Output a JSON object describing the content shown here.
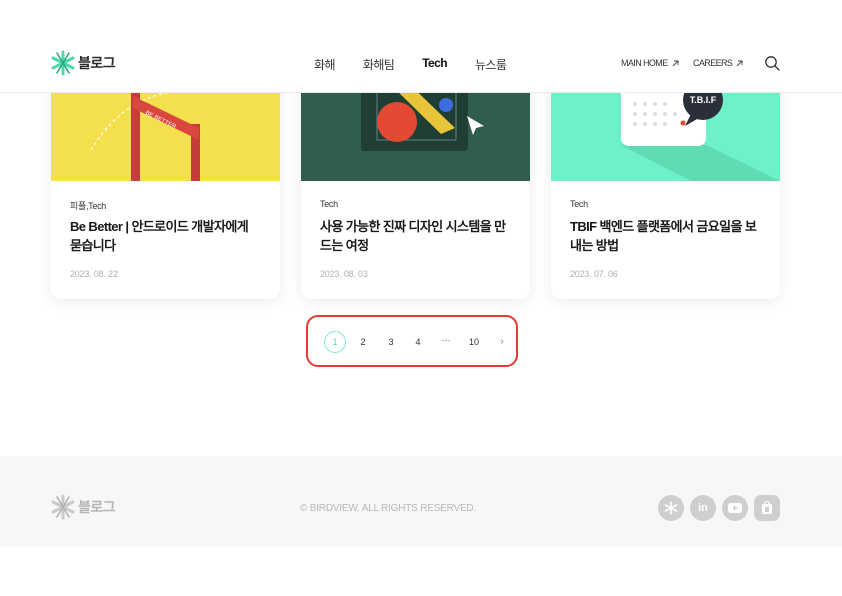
{
  "header": {
    "logo_text": "블로그",
    "nav": [
      "화해",
      "화해팀",
      "Tech",
      "뉴스룸"
    ],
    "active_nav": "Tech",
    "main_home": "MAIN HOME",
    "careers": "CAREERS"
  },
  "cards": [
    {
      "category": "피플,Tech",
      "title": "Be Better | 안드로이드 개발자에게 묻습니다",
      "date": "2023. 08. 22",
      "banner_text": "BE BETTER"
    },
    {
      "category": "Tech",
      "title": "사용 가능한 진짜 디자인 시스템을 만드는 여정",
      "date": "2023. 08. 03"
    },
    {
      "category": "Tech",
      "title": "TBIF 백엔드 플랫폼에서 금요일을 보내는 방법",
      "date": "2023. 07. 06",
      "bubble_text": "T.B.I.F"
    }
  ],
  "pagination": {
    "current": "1",
    "pages": [
      "1",
      "2",
      "3",
      "4",
      "10"
    ],
    "ellipsis": "···",
    "next": "›"
  },
  "footer": {
    "logo_text": "블로그",
    "copyright": "© BIRDVIEW. ALL RIGHTS RESERVED.",
    "social": [
      "hwahae-icon",
      "linkedin-icon",
      "youtube-icon",
      "app-store-icon"
    ],
    "linkedin_label": "in"
  },
  "colors": {
    "accent_mint": "#5ccfc0",
    "highlight_red": "#e53935",
    "card1_bg": "#f4e04d",
    "card2_bg": "#2f5d4e",
    "card3_bg": "#6ef0c8"
  }
}
